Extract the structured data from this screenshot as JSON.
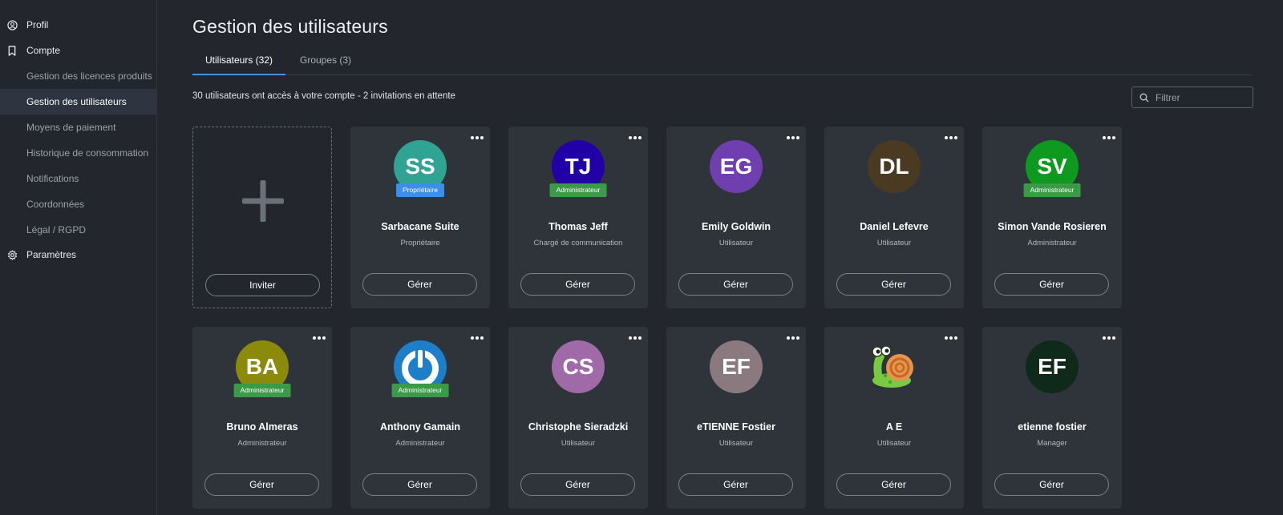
{
  "sidebar": {
    "profil": "Profil",
    "compte": "Compte",
    "sub_items": [
      "Gestion des licences produits",
      "Gestion des utilisateurs",
      "Moyens de paiement",
      "Historique de consommation",
      "Notifications",
      "Coordonnées",
      "Légal / RGPD"
    ],
    "active_index": 1,
    "parametres": "Paramètres"
  },
  "page": {
    "title": "Gestion des utilisateurs",
    "tabs": [
      "Utilisateurs (32)",
      "Groupes (3)"
    ],
    "summary": "30 utilisateurs ont accès à votre compte - 2 invitations en attente",
    "filter_placeholder": "Filtrer"
  },
  "invite": {
    "label": "Inviter"
  },
  "colors": {
    "accent": "#4a90e2",
    "badge_owner": "#3d8ee8",
    "badge_admin": "#3a9a48"
  },
  "users": [
    {
      "initials": "SS",
      "color": "#2fa394",
      "badge": "Propriétaire",
      "badge_type": "owner",
      "name": "Sarbacane Suite",
      "role": "Propriétaire",
      "action": "Gérer"
    },
    {
      "initials": "TJ",
      "color": "#2200a8",
      "badge": "Administrateur",
      "badge_type": "admin",
      "name": "Thomas Jeff",
      "role": "Chargé de communication",
      "action": "Gérer"
    },
    {
      "initials": "EG",
      "color": "#6f3fb0",
      "badge": "",
      "badge_type": "",
      "name": "Emily Goldwin",
      "role": "Utilisateur",
      "action": "Gérer"
    },
    {
      "initials": "DL",
      "color": "#4a3a22",
      "badge": "",
      "badge_type": "",
      "name": "Daniel Lefevre",
      "role": "Utilisateur",
      "action": "Gérer"
    },
    {
      "initials": "SV",
      "color": "#0d9a1e",
      "badge": "Administrateur",
      "badge_type": "admin",
      "name": "Simon Vande Rosieren",
      "role": "Administrateur",
      "action": "Gérer"
    },
    {
      "initials": "BA",
      "color": "#8c8a0a",
      "badge": "Administrateur",
      "badge_type": "admin",
      "name": "Bruno Almeras",
      "role": "Administrateur",
      "action": "Gérer"
    },
    {
      "initials": "",
      "color": "#1d7fc8",
      "avatar_icon": "power-logo-icon",
      "badge": "Administrateur",
      "badge_type": "admin",
      "name": "Anthony Gamain",
      "role": "Administrateur",
      "action": "Gérer"
    },
    {
      "initials": "CS",
      "color": "#a06aa8",
      "badge": "",
      "badge_type": "",
      "name": "Christophe Sieradzki",
      "role": "Utilisateur",
      "action": "Gérer"
    },
    {
      "initials": "EF",
      "color": "#8a7a80",
      "badge": "",
      "badge_type": "",
      "name": "eTIENNE Fostier",
      "role": "Utilisateur",
      "action": "Gérer"
    },
    {
      "initials": "",
      "color": "",
      "avatar_icon": "snail-icon",
      "badge": "",
      "badge_type": "",
      "name": "A E",
      "role": "Utilisateur",
      "action": "Gérer"
    },
    {
      "initials": "EF",
      "color": "#0f2a1a",
      "badge": "",
      "badge_type": "",
      "name": "etienne fostier",
      "role": "Manager",
      "action": "Gérer"
    }
  ]
}
